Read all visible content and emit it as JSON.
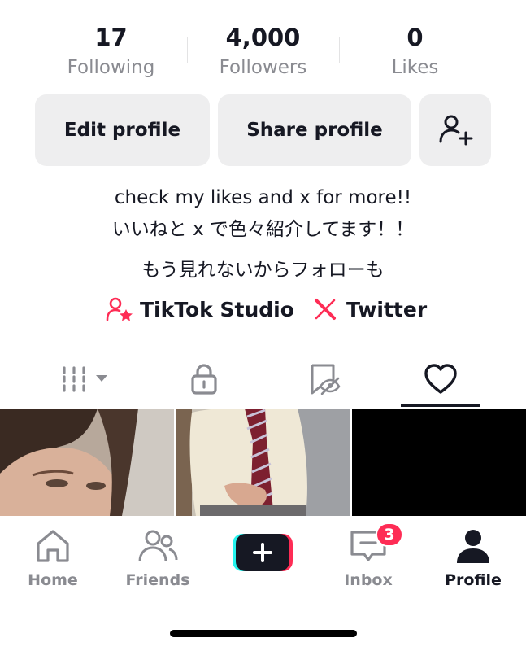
{
  "stats": [
    {
      "value": "17",
      "label": "Following"
    },
    {
      "value": "4,000",
      "label": "Followers"
    },
    {
      "value": "0",
      "label": "Likes"
    }
  ],
  "actions": {
    "edit_profile": "Edit profile",
    "share_profile": "Share profile",
    "add_friend_icon": "add-person-icon"
  },
  "bio": {
    "line1": "check my likes and x for more!!",
    "line2": "いいねと x で色々紹介してます！！",
    "line3": "もう見れないからフォローも"
  },
  "links": {
    "studio": "TikTok Studio",
    "twitter": "Twitter"
  },
  "tabs": [
    "grid-sort",
    "private",
    "reposts",
    "liked"
  ],
  "nav": {
    "home": "Home",
    "friends": "Friends",
    "inbox": "Inbox",
    "inbox_badge": "3",
    "profile": "Profile"
  },
  "colors": {
    "accent_pink": "#fe2c55",
    "accent_cyan": "#25f4ee",
    "text": "#161823",
    "muted": "#8a8b91"
  }
}
